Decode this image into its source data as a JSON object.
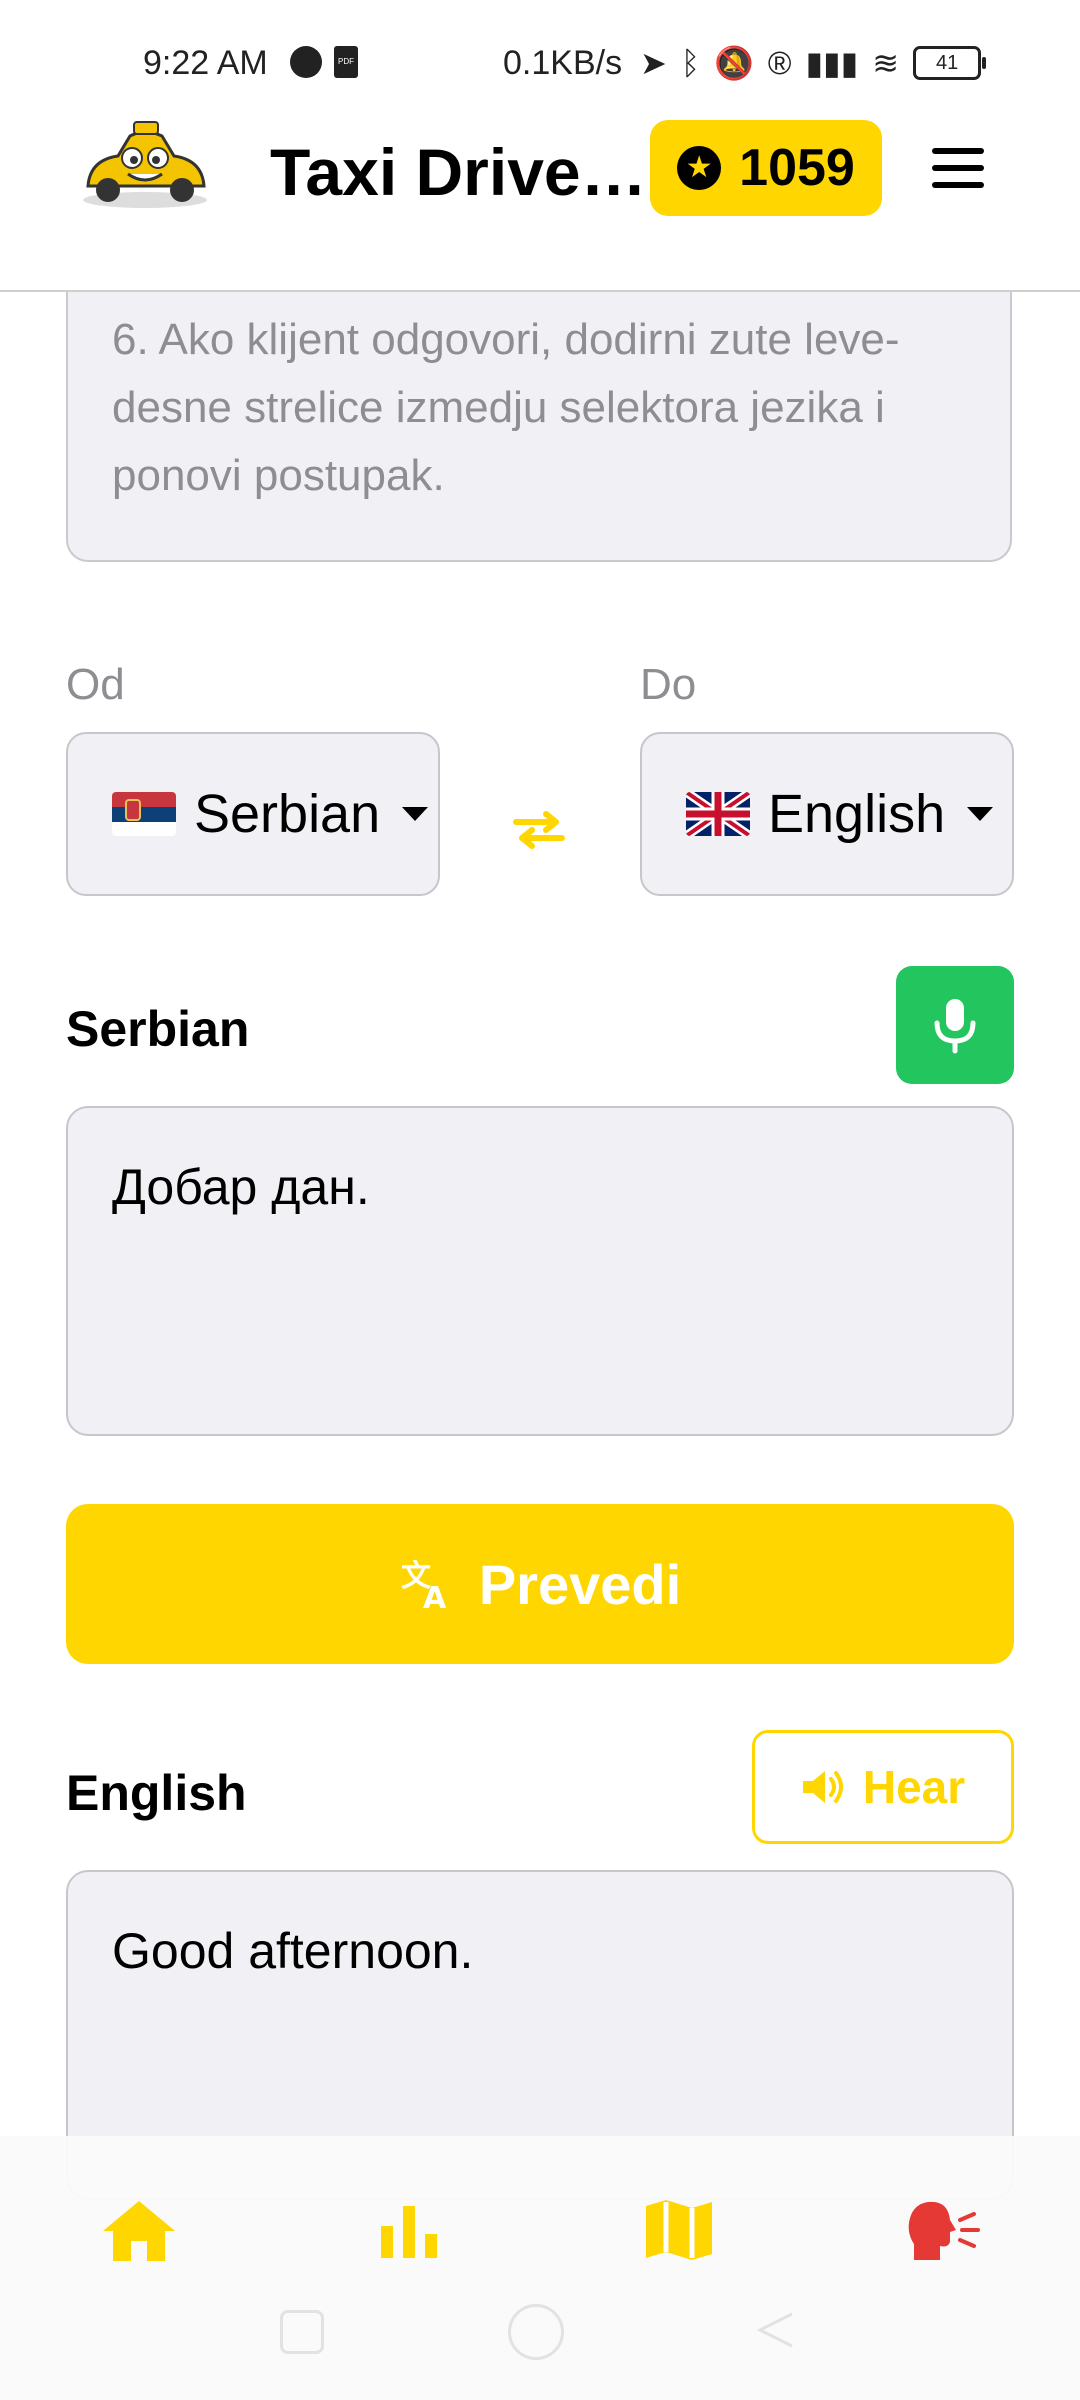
{
  "status_bar": {
    "time": "9:22 AM",
    "network_speed": "0.1KB/s",
    "battery": "41",
    "icons": [
      "spotify-icon",
      "pdf-icon",
      "location-icon",
      "bluetooth-icon",
      "mute-icon",
      "registered-icon",
      "signal-icon",
      "wifi-icon",
      "battery-icon"
    ]
  },
  "header": {
    "title": "Taxi Driver...",
    "points": "1059",
    "logo": "taxi-car-logo",
    "menu_icon": "hamburger-icon"
  },
  "instructions": {
    "text": "6. Ako klijent odgovori, dodirni zute leve-desne strelice izmedju selektora jezika i ponovi postupak."
  },
  "languages": {
    "from_label": "Od",
    "to_label": "Do",
    "from_value": "Serbian",
    "to_value": "English",
    "from_flag": "serbia-flag",
    "to_flag": "uk-flag",
    "swap_icon": "swap-arrows-icon"
  },
  "source": {
    "label": "Serbian",
    "text": "Добар дан."
  },
  "translate_button": {
    "label": "Prevedi"
  },
  "target": {
    "label": "English",
    "text": "Good afternoon.",
    "hear_label": "Hear"
  },
  "bottom_nav": [
    "home-icon",
    "stats-icon",
    "map-icon",
    "speak-icon"
  ],
  "colors": {
    "accent": "#ffd600",
    "mic": "#22c55e",
    "active_nav": "#e53935"
  }
}
